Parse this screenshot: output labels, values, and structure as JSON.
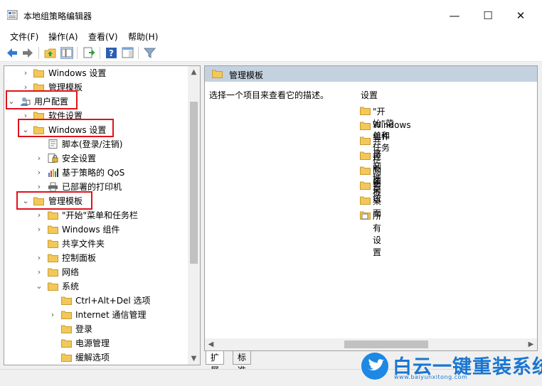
{
  "window": {
    "title": "本地组策略编辑器",
    "minimize_glyph": "—",
    "maximize_glyph": "☐",
    "close_glyph": "✕"
  },
  "menu": [
    "文件(F)",
    "操作(A)",
    "查看(V)",
    "帮助(H)"
  ],
  "toolbar": {
    "buttons": [
      "back-icon",
      "forward-icon",
      "up-folder-icon",
      "show-hide-tree-icon",
      "export-list-icon",
      "help-icon",
      "action-pane-icon",
      "filter-icon"
    ]
  },
  "tree": {
    "items": [
      {
        "label": "Windows 设置",
        "icon": "folder-icon",
        "expanded": false
      },
      {
        "label": "管理模板",
        "icon": "folder-icon",
        "expanded": false
      },
      {
        "label": "用户配置",
        "icon": "user-config-icon",
        "expanded": true
      },
      {
        "label": "软件设置",
        "icon": "folder-icon",
        "expanded": false
      },
      {
        "label": "Windows 设置",
        "icon": "folder-icon",
        "expanded": true
      },
      {
        "label": "脚本(登录/注销)",
        "icon": "script-icon"
      },
      {
        "label": "安全设置",
        "icon": "security-icon",
        "expanded": false
      },
      {
        "label": "基于策略的 QoS",
        "icon": "qos-chart-icon",
        "expanded": false
      },
      {
        "label": "已部署的打印机",
        "icon": "printer-icon",
        "expanded": false
      },
      {
        "label": "管理模板",
        "icon": "folder-icon",
        "expanded": true
      },
      {
        "label": "\"开始\"菜单和任务栏",
        "icon": "folder-icon",
        "expanded": false
      },
      {
        "label": "Windows 组件",
        "icon": "folder-icon",
        "expanded": false
      },
      {
        "label": "共享文件夹",
        "icon": "folder-icon"
      },
      {
        "label": "控制面板",
        "icon": "folder-icon",
        "expanded": false
      },
      {
        "label": "网络",
        "icon": "folder-icon",
        "expanded": false
      },
      {
        "label": "系统",
        "icon": "folder-icon",
        "expanded": true
      },
      {
        "label": "Ctrl+Alt+Del 选项",
        "icon": "folder-icon"
      },
      {
        "label": "Internet 通信管理",
        "icon": "folder-icon",
        "expanded": false
      },
      {
        "label": "登录",
        "icon": "folder-icon"
      },
      {
        "label": "电源管理",
        "icon": "folder-icon"
      },
      {
        "label": "缓解选项",
        "icon": "folder-icon"
      }
    ]
  },
  "right_pane": {
    "header": "管理模板",
    "description": "选择一个项目来查看它的描述。",
    "list_header": "设置",
    "items": [
      {
        "label": "\"开始\"菜单和任务栏",
        "icon": "folder-icon"
      },
      {
        "label": "Windows 组件",
        "icon": "folder-icon"
      },
      {
        "label": "共享文件夹",
        "icon": "folder-icon"
      },
      {
        "label": "控制面板",
        "icon": "folder-icon"
      },
      {
        "label": "网络",
        "icon": "folder-icon"
      },
      {
        "label": "系统",
        "icon": "folder-icon"
      },
      {
        "label": "桌面",
        "icon": "folder-icon"
      },
      {
        "label": "所有设置",
        "icon": "all-settings-icon"
      }
    ]
  },
  "tabs": [
    "扩展",
    "标准"
  ],
  "watermark": {
    "text": "白云一键重装系统",
    "url": "www.baiyunxitong.com"
  },
  "colors": {
    "highlight": "#e0131a",
    "header_bg": "#c4d2e0",
    "folder": "#f2c85b",
    "watermark": "#1976d2"
  }
}
